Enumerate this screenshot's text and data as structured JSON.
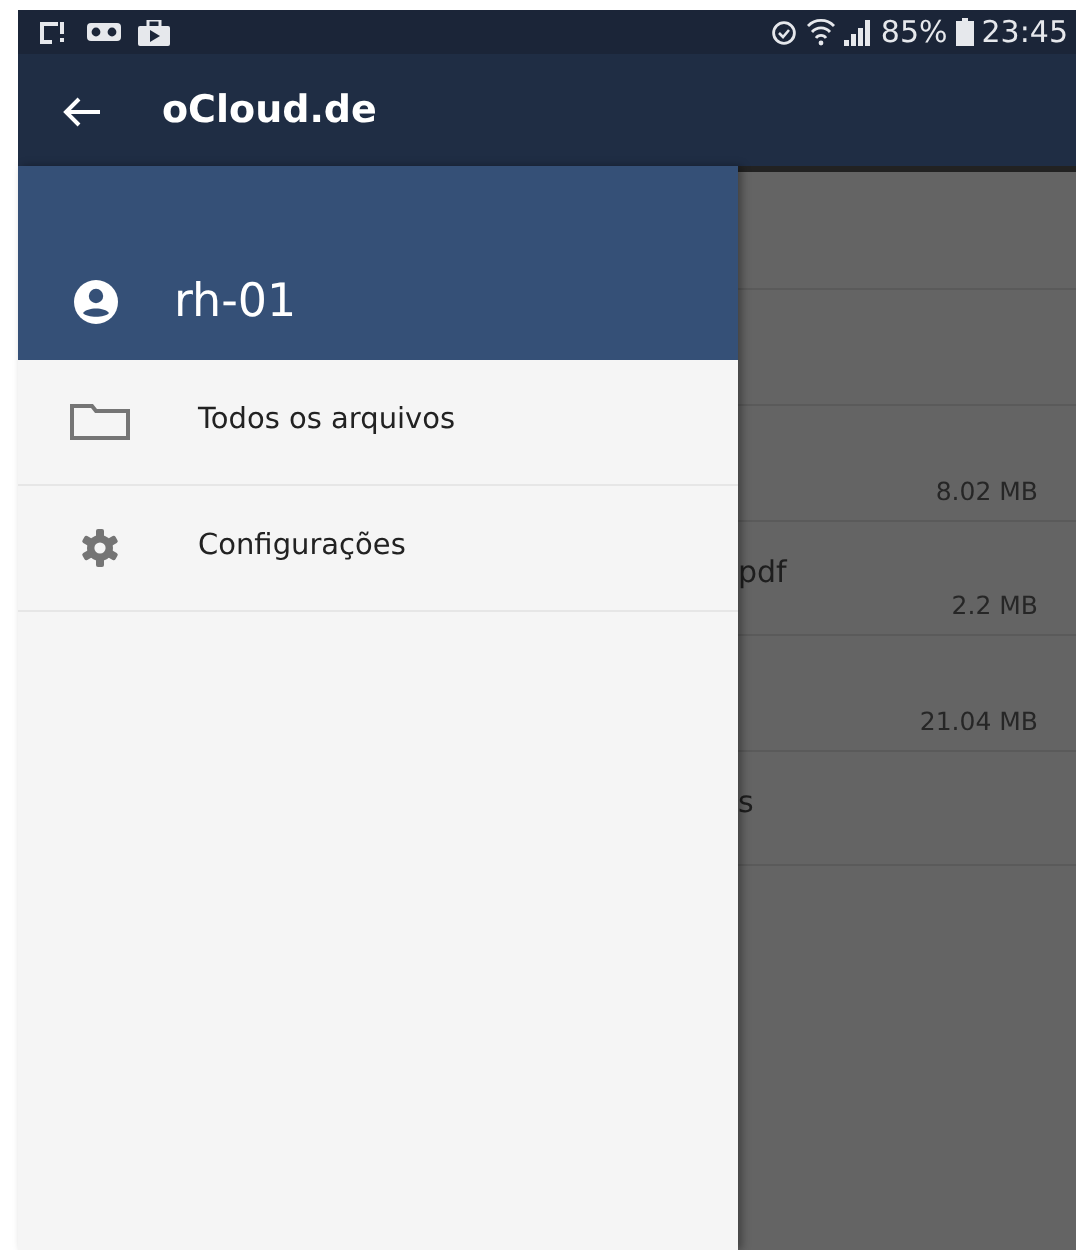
{
  "status_bar": {
    "battery": "85%",
    "time": "23:45"
  },
  "app_bar": {
    "title": "oCloud.de"
  },
  "drawer": {
    "account": "rh-01",
    "items": [
      {
        "kind": "folder",
        "label": "Todos os arquivos"
      },
      {
        "kind": "settings",
        "label": "Configurações"
      }
    ]
  },
  "file_list": [
    {
      "size": "8.02 MB"
    },
    {
      "name": "pdf",
      "size": "2.2 MB"
    },
    {
      "size": "21.04 MB"
    },
    {
      "name": "s"
    }
  ]
}
